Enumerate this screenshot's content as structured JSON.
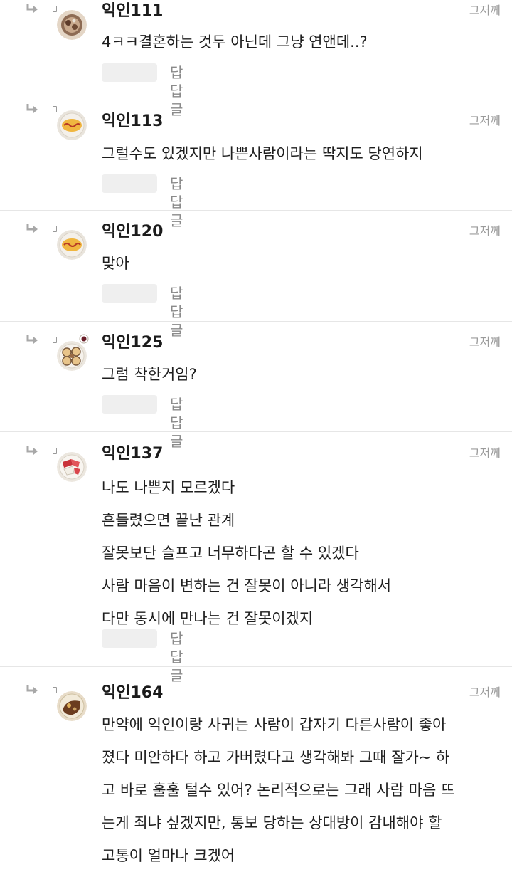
{
  "time_label": "그저께",
  "reply_label": "답답글",
  "comments": [
    {
      "name": "익인111",
      "avatar": "noodle-bowl-icon",
      "lines": [
        "4ㅋㅋ결혼하는 것두 아닌데 그냥 연앤데..?"
      ]
    },
    {
      "name": "익인113",
      "avatar": "omelet-plate-icon",
      "lines": [
        "그럴수도 있겠지만 나쁜사람이라는 딱지도 당연하지"
      ]
    },
    {
      "name": "익인120",
      "avatar": "omelet-plate-icon",
      "lines": [
        "맞아"
      ]
    },
    {
      "name": "익인125",
      "avatar": "dumpling-plate-icon",
      "lines": [
        "그럼 착한거임?"
      ]
    },
    {
      "name": "익인137",
      "avatar": "sashimi-plate-icon",
      "lines": [
        "나도 나쁜지 모르겠다",
        "흔들렸으면 끝난 관계",
        "잘못보단 슬프고 너무하다곤 할 수 있겠다",
        "사람 마음이 변하는 건 잘못이 아니라 생각해서",
        "다만 동시에 만나는 건 잘못이겠지"
      ]
    },
    {
      "name": "익인164",
      "avatar": "curry-plate-icon",
      "lines": [
        "만약에 익인이랑 사귀는 사람이 갑자기 다른사람이 좋아",
        "졌다 미안하다 하고 가버렸다고 생각해봐 그때 잘가~ 하",
        "고 바로 훌훌 털수 있어? 논리적으로는 그래 사람 마음 뜨",
        "는게 죄냐 싶겠지만, 통보 당하는 상대방이 감내해야 할",
        "고통이 얼마나 크겠어"
      ]
    }
  ]
}
